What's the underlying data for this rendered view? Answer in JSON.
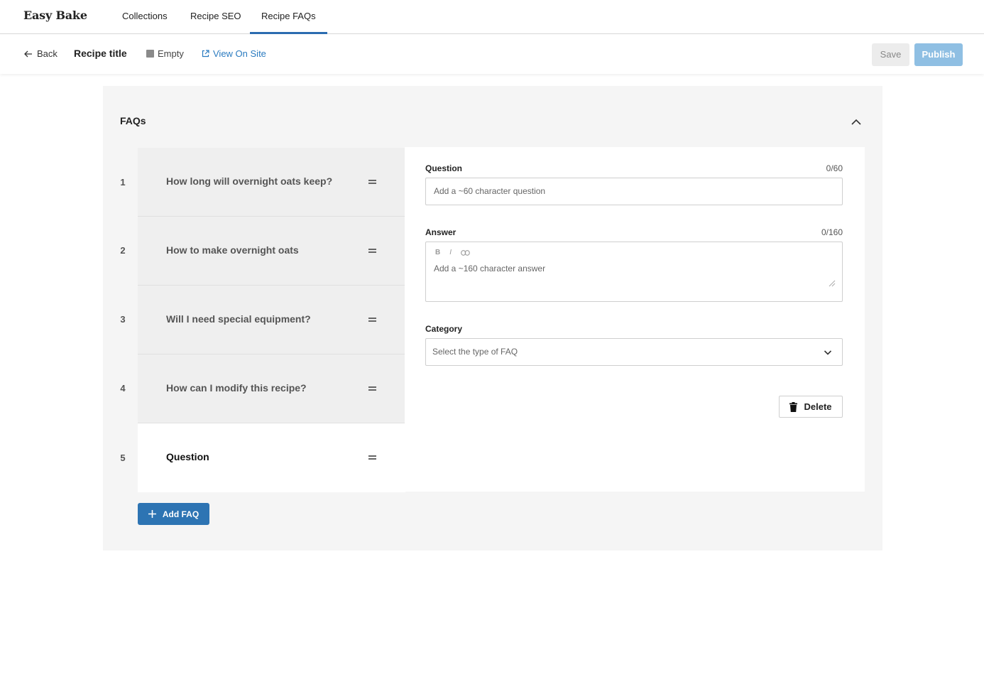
{
  "app": {
    "brand": "Easy Bake"
  },
  "nav": {
    "tabs": [
      {
        "label": "Collections",
        "active": false
      },
      {
        "label": "Recipe SEO",
        "active": false
      },
      {
        "label": "Recipe FAQs",
        "active": true
      }
    ]
  },
  "toolbar": {
    "back_label": "Back",
    "recipe_title": "Recipe title",
    "status_label": "Empty",
    "view_on_site_label": "View On Site",
    "save_label": "Save",
    "publish_label": "Publish"
  },
  "faqs": {
    "title": "FAQs",
    "items": [
      {
        "number": "1",
        "question": "How long will overnight oats keep?"
      },
      {
        "number": "2",
        "question": "How to make overnight oats"
      },
      {
        "number": "3",
        "question": "Will I need special equipment?"
      },
      {
        "number": "4",
        "question": "How can I modify this recipe?"
      },
      {
        "number": "5",
        "question": "Question",
        "selected": true
      }
    ],
    "add_label": "Add FAQ"
  },
  "editor": {
    "question": {
      "label": "Question",
      "count": "0/60",
      "placeholder": "Add a ~60 character question"
    },
    "answer": {
      "label": "Answer",
      "count": "0/160",
      "placeholder": "Add a ~160 character answer",
      "tools": [
        "B",
        "I",
        "link"
      ]
    },
    "category": {
      "label": "Category",
      "placeholder": "Select the type of FAQ"
    },
    "delete_label": "Delete"
  },
  "colors": {
    "accent": "#2d74b3",
    "publish_disabled": "#8fbfe3",
    "link": "#2b7bc0"
  }
}
